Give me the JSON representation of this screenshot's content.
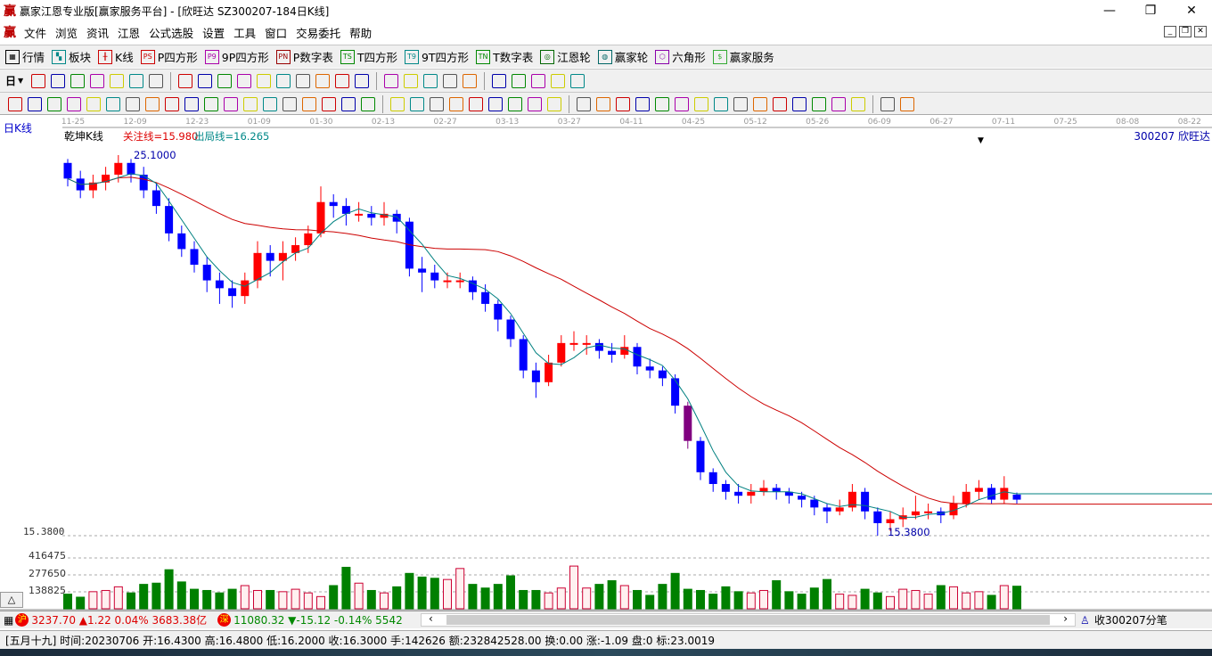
{
  "window": {
    "logo": "赢",
    "title": "赢家江恩专业版[赢家服务平台] - [欣旺达  SZ300207-184日K线]",
    "minimize": "—",
    "restore": "❐",
    "close": "✕"
  },
  "menu": {
    "logo": "赢",
    "items": [
      "文件",
      "浏览",
      "资讯",
      "江恩",
      "公式选股",
      "设置",
      "工具",
      "窗口",
      "交易委托",
      "帮助"
    ],
    "mdi": [
      "_",
      "❐",
      "✕"
    ]
  },
  "toolbar1": [
    {
      "icon": "table-icon",
      "glyph": "▦",
      "label": "行情",
      "color": "#000"
    },
    {
      "icon": "blocks-icon",
      "glyph": "▚",
      "label": "板块",
      "color": "#088"
    },
    {
      "icon": "kline-icon",
      "glyph": "╫",
      "label": "K线",
      "color": "#c00"
    },
    {
      "icon": "ps-icon",
      "glyph": "PS",
      "label": "P四方形",
      "color": "#c00"
    },
    {
      "icon": "p9-icon",
      "glyph": "P9",
      "label": "9P四方形",
      "color": "#a0a"
    },
    {
      "icon": "pn-icon",
      "glyph": "PN",
      "label": "P数字表",
      "color": "#900"
    },
    {
      "icon": "ts-icon",
      "glyph": "TS",
      "label": "T四方形",
      "color": "#080"
    },
    {
      "icon": "t9-icon",
      "glyph": "T9",
      "label": "9T四方形",
      "color": "#088"
    },
    {
      "icon": "tn-icon",
      "glyph": "TN",
      "label": "T数字表",
      "color": "#080"
    },
    {
      "icon": "gann-wheel-icon",
      "glyph": "◎",
      "label": "江恩轮",
      "color": "#060"
    },
    {
      "icon": "winner-wheel-icon",
      "glyph": "◍",
      "label": "赢家轮",
      "color": "#066"
    },
    {
      "icon": "hexagon-icon",
      "glyph": "⬡",
      "label": "六角形",
      "color": "#80a"
    },
    {
      "icon": "dollar-icon",
      "glyph": "$",
      "label": "赢家服务",
      "color": "#3a3"
    }
  ],
  "toolbar2": {
    "period": "日",
    "icons": [
      "kline-mode-icon",
      "notes-icon",
      "chart-3-icon",
      "chart-9-icon",
      "candle-icon",
      "gann-icon",
      "fan-icon",
      "sep",
      "first-icon",
      "last-icon",
      "prev-icon",
      "next-icon",
      "zoom-left-icon",
      "zoom-right-icon",
      "expand-icon",
      "shrink-icon",
      "compress-icon",
      "fit-icon",
      "sep",
      "hand-icon",
      "crosshair-icon",
      "draw-line-icon",
      "pattern-icon",
      "cycle-icon",
      "sep",
      "calendar-icon",
      "calculator-icon",
      "report-icon",
      "save-icon",
      "print-icon"
    ]
  },
  "toolbar3": {
    "icons": [
      "pen-icon",
      "parallel-icon",
      "gold-icon",
      "gold2-icon",
      "f-line-icon",
      "spiral-icon",
      "brush-icon",
      "circle-icon",
      "grid-lines-icon",
      "n2-icon",
      "angle-icon",
      "target-icon",
      "radar-icon",
      "square-icon",
      "ray-icon",
      "shen-icon",
      "ying-icon",
      "comb-icon",
      "span-icon",
      "sep",
      "box-icon",
      "fan-lines-icon",
      "arc-icon",
      "square-fan-icon",
      "angle-fan-icon",
      "v-icon",
      "grid-icon",
      "grid2-icon",
      "diag-icon",
      "sep",
      "list-icon",
      "percent-red-icon",
      "percent-icon",
      "percent-lines-icon",
      "gold-circle-icon",
      "gold-lines-icon",
      "rocket-icon",
      "wave-icon",
      "gold-box-icon",
      "j-angle-icon",
      "f-angle-icon",
      "fib-angle-icon",
      "shen-angle-icon",
      "ying-angle-icon",
      "four-angle-icon",
      "sep",
      "taiji-icon",
      "infinity-icon"
    ]
  },
  "chart": {
    "period_label": "日K线",
    "indicator_name": "乾坤K线",
    "focus_line": "关注线=15.980",
    "exit_line": "出局线=16.265",
    "stock": "300207 欣旺达",
    "high_label": "25.1000",
    "low_label": "15.3800",
    "axis_low": "15.3800",
    "dates": [
      "11-25",
      "12-09",
      "12-23",
      "01-09",
      "01-30",
      "02-13",
      "02-27",
      "03-13",
      "03-27",
      "04-11",
      "04-25",
      "05-12",
      "05-26",
      "06-09",
      "06-27",
      "07-11",
      "07-25",
      "08-08",
      "08-22"
    ],
    "vol_ticks": [
      "416475",
      "277650",
      "138825"
    ],
    "colors": {
      "up": "#ff0000",
      "down": "#0000ff",
      "focus": "#800080",
      "ma_long": "#cc0000",
      "ma_short": "#008080",
      "vol_up": "#cc0033",
      "vol_down": "#008000"
    }
  },
  "chart_data": {
    "type": "candlestick",
    "price_range": [
      15.38,
      25.1
    ],
    "vol_max": 416475,
    "open": [
      24.9,
      24.5,
      24.2,
      24.4,
      24.6,
      24.9,
      24.6,
      24.2,
      23.8,
      23.1,
      22.7,
      22.3,
      21.9,
      21.7,
      21.5,
      21.9,
      22.6,
      22.4,
      22.6,
      22.8,
      23.1,
      23.9,
      23.8,
      23.6,
      23.6,
      23.5,
      23.6,
      23.4,
      22.2,
      22.1,
      21.9,
      21.9,
      21.9,
      21.6,
      21.3,
      20.9,
      20.4,
      19.6,
      19.3,
      19.8,
      20.3,
      20.3,
      20.3,
      20.1,
      20.0,
      20.2,
      19.7,
      19.6,
      19.4,
      18.7,
      17.8,
      17.0,
      16.7,
      16.5,
      16.4,
      16.5,
      16.6,
      16.5,
      16.4,
      16.3,
      16.1,
      16.0,
      16.1,
      16.5,
      16.0,
      15.7,
      15.8,
      15.9,
      16.0,
      16.0,
      15.9,
      16.2,
      16.5,
      16.6,
      16.3,
      16.43
    ],
    "high": [
      25.0,
      24.7,
      24.6,
      24.8,
      25.1,
      25.0,
      24.8,
      24.4,
      24.0,
      23.3,
      22.9,
      22.5,
      22.1,
      21.9,
      22.1,
      22.9,
      22.8,
      22.9,
      23.0,
      23.3,
      24.3,
      24.1,
      24.0,
      23.9,
      23.8,
      23.9,
      23.7,
      23.5,
      22.5,
      22.3,
      22.1,
      22.1,
      22.0,
      21.8,
      21.4,
      21.0,
      20.5,
      19.8,
      20.0,
      20.5,
      20.6,
      20.5,
      20.4,
      20.3,
      20.5,
      20.3,
      19.9,
      19.7,
      19.5,
      18.8,
      17.9,
      17.1,
      16.8,
      16.7,
      16.7,
      16.8,
      16.7,
      16.6,
      16.5,
      16.4,
      16.2,
      16.3,
      16.7,
      16.6,
      16.1,
      16.0,
      16.1,
      16.4,
      16.2,
      16.1,
      16.4,
      16.7,
      16.8,
      16.7,
      16.9,
      16.48
    ],
    "low": [
      24.3,
      24.0,
      24.0,
      24.2,
      24.4,
      24.4,
      24.0,
      23.6,
      22.9,
      22.5,
      22.1,
      21.6,
      21.3,
      21.2,
      21.3,
      21.7,
      22.0,
      21.9,
      22.4,
      22.6,
      23.0,
      23.5,
      23.3,
      23.4,
      23.3,
      23.3,
      23.1,
      22.0,
      21.6,
      21.7,
      21.7,
      21.7,
      21.4,
      21.1,
      20.6,
      20.2,
      19.4,
      18.9,
      19.2,
      19.7,
      20.1,
      20.0,
      19.9,
      19.8,
      19.9,
      19.5,
      19.4,
      19.2,
      18.5,
      17.6,
      16.8,
      16.5,
      16.3,
      16.2,
      16.2,
      16.4,
      16.3,
      16.2,
      16.1,
      15.9,
      15.7,
      15.9,
      16.0,
      15.8,
      15.38,
      15.5,
      15.6,
      15.8,
      15.8,
      15.7,
      15.8,
      16.1,
      16.3,
      16.2,
      16.2,
      16.2
    ],
    "close": [
      24.5,
      24.2,
      24.4,
      24.6,
      24.9,
      24.6,
      24.2,
      23.8,
      23.1,
      22.7,
      22.3,
      21.9,
      21.7,
      21.5,
      21.9,
      22.6,
      22.4,
      22.6,
      22.8,
      23.1,
      23.9,
      23.8,
      23.6,
      23.6,
      23.5,
      23.6,
      23.4,
      22.2,
      22.1,
      21.9,
      21.9,
      21.9,
      21.6,
      21.3,
      20.9,
      20.4,
      19.6,
      19.3,
      19.8,
      20.3,
      20.3,
      20.3,
      20.1,
      20.0,
      20.2,
      19.7,
      19.6,
      19.4,
      18.7,
      17.8,
      17.0,
      16.7,
      16.5,
      16.4,
      16.5,
      16.6,
      16.5,
      16.4,
      16.3,
      16.1,
      16.0,
      16.1,
      16.5,
      16.0,
      15.7,
      15.8,
      15.9,
      16.0,
      16.0,
      15.9,
      16.2,
      16.5,
      16.6,
      16.3,
      16.6,
      16.3
    ],
    "volume": [
      120000,
      95000,
      140000,
      150000,
      180000,
      130000,
      200000,
      210000,
      320000,
      220000,
      160000,
      150000,
      130000,
      160000,
      190000,
      150000,
      150000,
      140000,
      160000,
      130000,
      100000,
      190000,
      340000,
      210000,
      150000,
      130000,
      180000,
      290000,
      260000,
      250000,
      240000,
      330000,
      200000,
      170000,
      200000,
      270000,
      150000,
      150000,
      130000,
      170000,
      350000,
      170000,
      200000,
      230000,
      190000,
      150000,
      110000,
      200000,
      290000,
      160000,
      150000,
      120000,
      180000,
      140000,
      130000,
      150000,
      230000,
      140000,
      120000,
      170000,
      240000,
      120000,
      110000,
      160000,
      130000,
      100000,
      160000,
      150000,
      120000,
      190000,
      180000,
      130000,
      140000,
      110000,
      190000,
      185000
    ]
  },
  "index_bar": {
    "sh_badge": "沪",
    "sh": "3237.70 ▲1.22 0.04% 3683.38亿",
    "sz_badge": "深",
    "sz": "11080.32 ▼-15.12 -0.14% 5542.38",
    "scroll_left": "‹",
    "scroll_right": "›",
    "tick_label": "收300207分笔"
  },
  "status": "[五月十九] 时间:20230706 开:16.4300 高:16.4800 低:16.2000 收:16.3000 手:142626 额:232842528.00 换:0.00 涨:-1.09 盘:0 标:23.0019",
  "collapse_button": "△"
}
